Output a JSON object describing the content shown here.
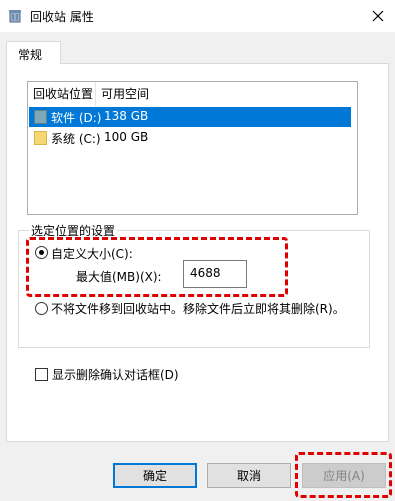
{
  "window": {
    "title": "回收站 属性",
    "close_icon": "close-icon"
  },
  "tabs": [
    {
      "label": "常规",
      "active": true
    }
  ],
  "listview": {
    "columns": [
      "回收站位置",
      "可用空间"
    ],
    "rows": [
      {
        "location": "软件 (D:)",
        "free_space": "138 GB",
        "selected": true,
        "icon": "drive-icon"
      },
      {
        "location": "系统 (C:)",
        "free_space": "100 GB",
        "selected": false,
        "icon": "folder-icon"
      }
    ]
  },
  "settings_group": {
    "label": "选定位置的设置",
    "custom_size_label": "自定义大小(C):",
    "custom_size_selected": true,
    "max_size_label": "最大值(MB)(X):",
    "max_size_value": "4688",
    "delete_immediately_label": "不将文件移到回收站中。移除文件后立即将其删除(R)。",
    "delete_immediately_selected": false
  },
  "confirm_dialog": {
    "label": "显示删除确认对话框(D)",
    "checked": false
  },
  "buttons": {
    "ok": "确定",
    "cancel": "取消",
    "apply": "应用(A)"
  },
  "colors": {
    "selection": "#0078d7",
    "highlight": "#e00000",
    "folder": "#f7d774"
  }
}
